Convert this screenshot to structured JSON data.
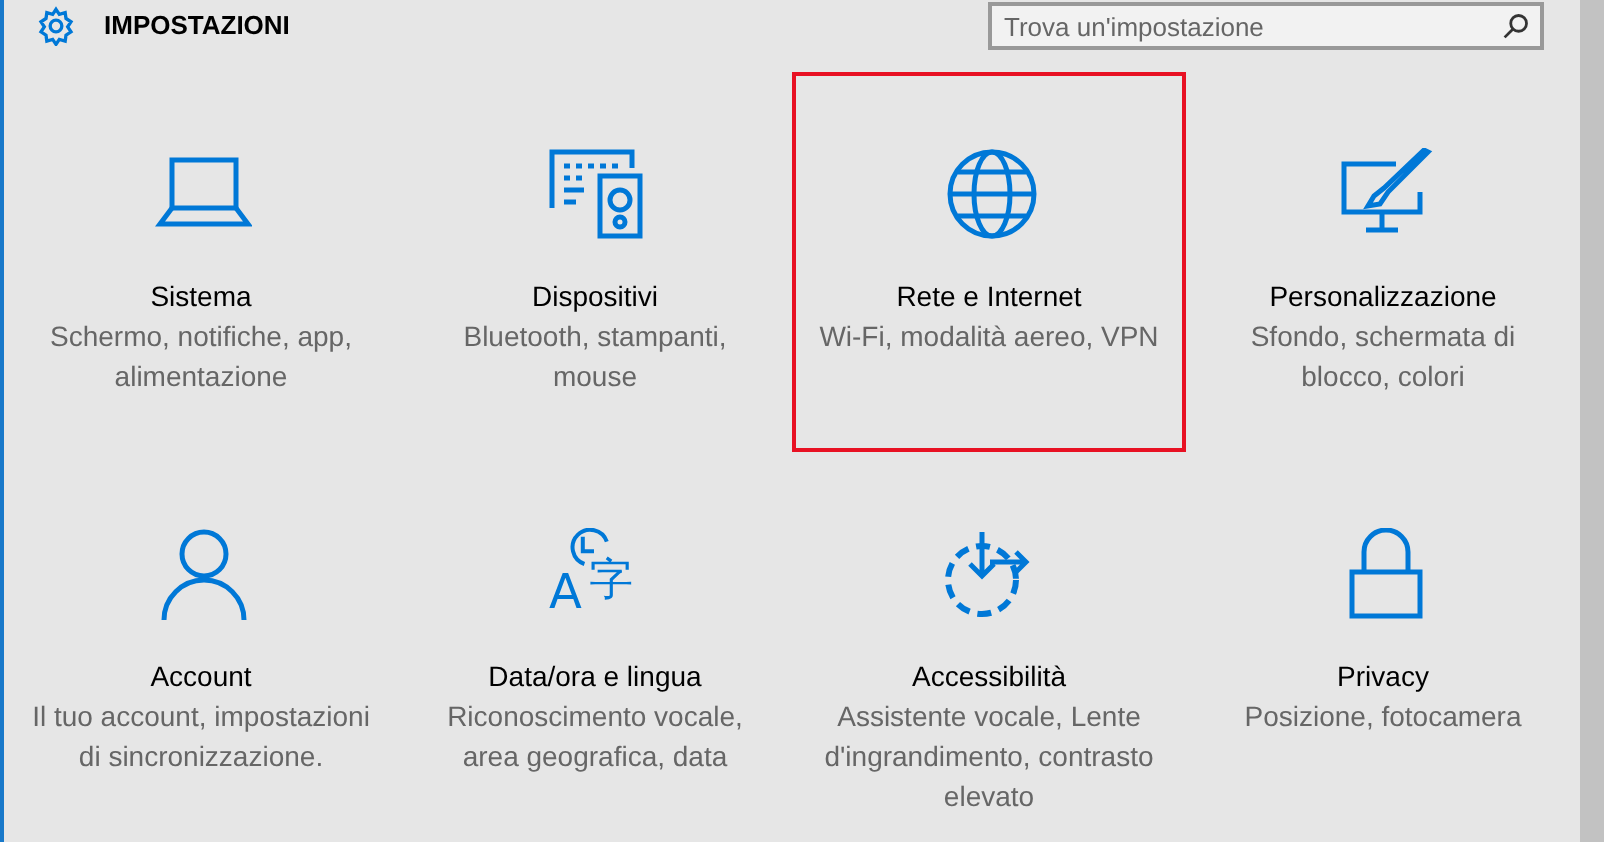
{
  "header": {
    "title": "IMPOSTAZIONI",
    "search": {
      "placeholder": "Trova un'impostazione"
    }
  },
  "tiles": [
    {
      "kind": "laptop",
      "title": "Sistema",
      "description": "Schermo, notifiche, app, alimentazione",
      "selected": false
    },
    {
      "kind": "devices",
      "title": "Dispositivi",
      "description": "Bluetooth, stampanti, mouse",
      "selected": false
    },
    {
      "kind": "globe",
      "title": "Rete e Internet",
      "description": "Wi-Fi, modalità aereo, VPN",
      "selected": true
    },
    {
      "kind": "brush",
      "title": "Personalizzazione",
      "description": "Sfondo, schermata di blocco, colori",
      "selected": false
    },
    {
      "kind": "person",
      "title": "Account",
      "description": "Il tuo account, impostazioni di sincronizzazione.",
      "selected": false
    },
    {
      "kind": "language",
      "icon_text": [
        "A",
        "字"
      ],
      "title": "Data/ora e lingua",
      "description": "Riconoscimento vocale, area geografica, data",
      "selected": false
    },
    {
      "kind": "access",
      "title": "Accessibilità",
      "description": "Assistente vocale, Lente d'ingrandimento, contrasto elevato",
      "selected": false
    },
    {
      "kind": "lock",
      "title": "Privacy",
      "description": "Posizione, fotocamera",
      "selected": false
    }
  ]
}
